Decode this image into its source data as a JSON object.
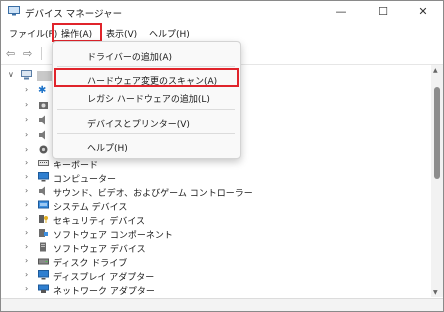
{
  "window": {
    "title": "デバイス マネージャー",
    "controls": {
      "minimize": "—",
      "maximize": "☐",
      "close": "✕"
    }
  },
  "menubar": {
    "items": [
      {
        "label": "ファイル(F)"
      },
      {
        "label": "操作(A)",
        "highlighted": true
      },
      {
        "label": "表示(V)"
      },
      {
        "label": "ヘルプ(H)"
      }
    ]
  },
  "toolbar": {
    "back_icon": "back-arrow-icon",
    "forward_icon": "forward-arrow-icon"
  },
  "action_menu": {
    "items": [
      {
        "label": "ドライバーの追加(A)"
      },
      {
        "label": "ハードウェア変更のスキャン(A)",
        "highlighted": true
      },
      {
        "label": "レガシ ハードウェアの追加(L)"
      },
      {
        "label": "デバイスとプリンター(V)"
      },
      {
        "label": "ヘルプ(H)"
      }
    ]
  },
  "tree": {
    "items": [
      {
        "label": "キーボード",
        "icon": "keyboard-icon"
      },
      {
        "label": "コンピューター",
        "icon": "computer-icon"
      },
      {
        "label": "サウンド、ビデオ、およびゲーム コントローラー",
        "icon": "speaker-icon"
      },
      {
        "label": "システム デバイス",
        "icon": "system-device-icon"
      },
      {
        "label": "セキュリティ デバイス",
        "icon": "security-device-icon"
      },
      {
        "label": "ソフトウェア コンポーネント",
        "icon": "software-component-icon"
      },
      {
        "label": "ソフトウェア デバイス",
        "icon": "software-device-icon"
      },
      {
        "label": "ディスク ドライブ",
        "icon": "disk-drive-icon"
      },
      {
        "label": "ディスプレイ アダプター",
        "icon": "display-adapter-icon"
      },
      {
        "label": "ネットワーク アダプター",
        "icon": "network-adapter-icon"
      }
    ]
  },
  "colors": {
    "highlight": "#e0242b",
    "menu_bg": "#f9f9f9",
    "accent": "#1e73c8"
  }
}
